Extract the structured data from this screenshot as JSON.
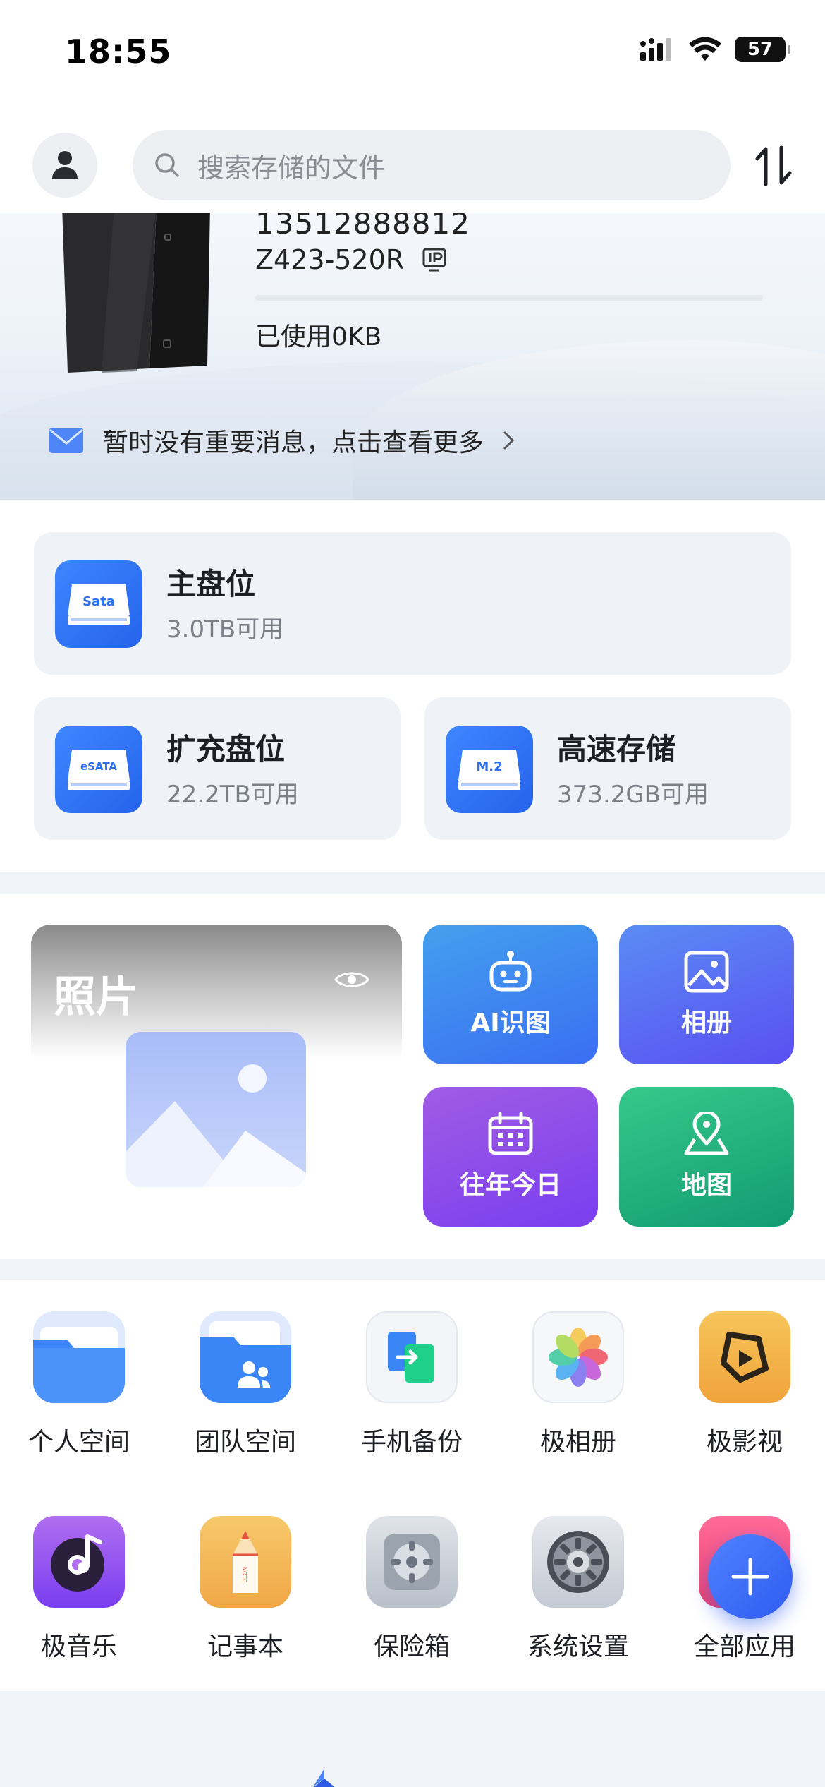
{
  "status_bar": {
    "time": "18:55",
    "battery": "57"
  },
  "header": {
    "search_placeholder": "搜索存储的文件"
  },
  "device": {
    "id": "13512888812",
    "model": "Z423-520R",
    "used": "已使用0KB",
    "usage_fraction": 0,
    "notice": "暂时没有重要消息，点击查看更多"
  },
  "storage": {
    "main": {
      "title": "主盘位",
      "available": "3.0TB可用",
      "icon_text": "Sata"
    },
    "expansion": {
      "title": "扩充盘位",
      "available": "22.2TB可用",
      "icon_text": "eSATA"
    },
    "highspeed": {
      "title": "高速存储",
      "available": "373.2GB可用",
      "icon_text": "M.2"
    }
  },
  "photos": {
    "title": "照片",
    "tiles": [
      {
        "label": "AI识图",
        "icon": "robot-icon",
        "color": "#3a7ff3"
      },
      {
        "label": "相册",
        "icon": "image-icon",
        "color": "#5a63f5"
      },
      {
        "label": "往年今日",
        "icon": "calendar-icon",
        "color": "#8a4ce8"
      },
      {
        "label": "地图",
        "icon": "map-pin-icon",
        "color": "#1fa37a"
      }
    ]
  },
  "apps": [
    {
      "label": "个人空间",
      "icon": "folder-icon"
    },
    {
      "label": "团队空间",
      "icon": "team-folder-icon"
    },
    {
      "label": "手机备份",
      "icon": "phone-backup-icon"
    },
    {
      "label": "极相册",
      "icon": "photos-flower-icon"
    },
    {
      "label": "极影视",
      "icon": "film-icon"
    },
    {
      "label": "极音乐",
      "icon": "music-icon"
    },
    {
      "label": "记事本",
      "icon": "notebook-icon"
    },
    {
      "label": "保险箱",
      "icon": "safe-icon"
    },
    {
      "label": "系统设置",
      "icon": "settings-gear-icon"
    },
    {
      "label": "全部应用",
      "icon": "all-apps-icon"
    }
  ]
}
